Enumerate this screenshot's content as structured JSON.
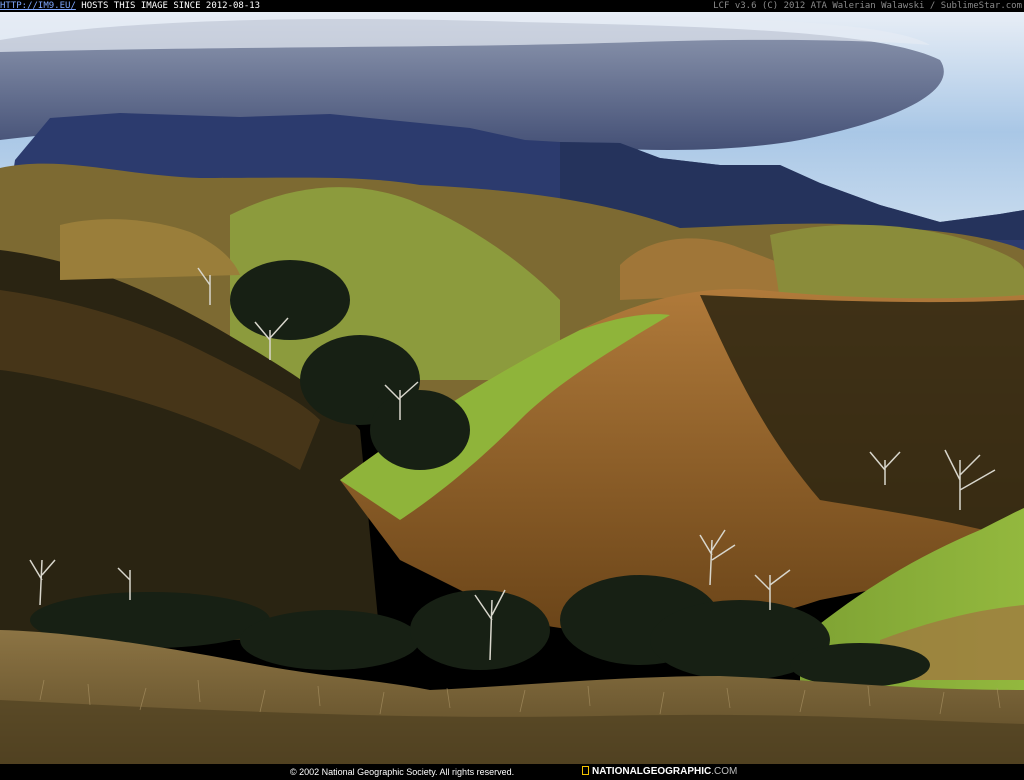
{
  "header": {
    "link_text": "HTTP://IM9.EU/",
    "host_text": " HOSTS THIS IMAGE SINCE 2012-08-13",
    "credit_text": "LCF v3.6 (C) 2012 ATA Walerian Walawski / SublimeStar.com"
  },
  "footer": {
    "copyright_text": "© 2002 National Geographic Society. All rights reserved.",
    "brand_name": "NATIONALGEOGRAPHIC",
    "brand_suffix": ".COM"
  },
  "colors": {
    "sky": "#a9c7e6",
    "cloud": "#5d6a8a",
    "mountain": "#2c3b6e",
    "grass_lit": "#8cb43a",
    "grass_dry": "#a86a30",
    "shadow": "#1d1a10",
    "brand_yellow": "#f2c200"
  }
}
